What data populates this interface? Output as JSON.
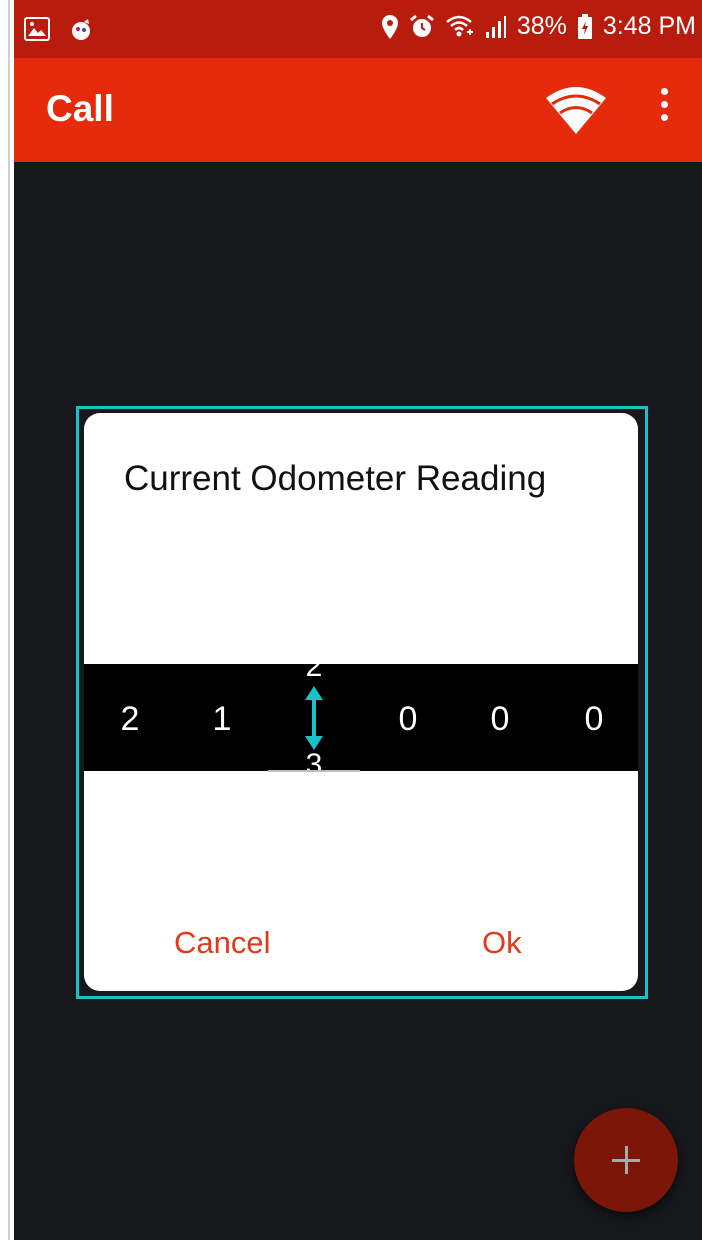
{
  "status_bar": {
    "battery": "38%",
    "time": "3:48 PM",
    "left_icons": [
      "gallery-icon",
      "app-notification-icon"
    ],
    "right_icons": [
      "location-icon",
      "alarm-icon",
      "wifi-calling-icon",
      "signal-icon",
      "battery-charging-icon"
    ]
  },
  "app_bar": {
    "title": "Call",
    "actions": [
      "wifi-icon",
      "more-vert-icon"
    ]
  },
  "dialog": {
    "title": "Current Odometer Reading",
    "digits": [
      "2",
      "1",
      "",
      "0",
      "0",
      "0"
    ],
    "active_digit": {
      "above": "2",
      "below": "3"
    },
    "cancel_label": "Cancel",
    "ok_label": "Ok"
  },
  "fab": {
    "icon": "plus-icon"
  },
  "colors": {
    "status_bar": "#b71c0c",
    "app_bar": "#e62a0c",
    "accent": "#19c2c9",
    "button_text": "#e03a1a",
    "fab": "#7c1608",
    "background": "#17181c"
  }
}
